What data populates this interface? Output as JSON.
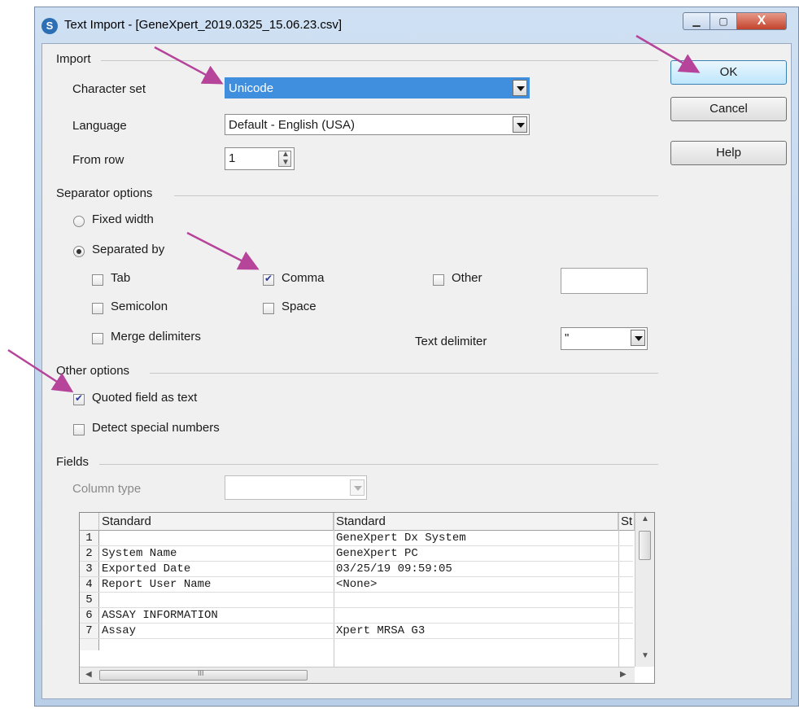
{
  "window": {
    "title": "Text Import - [GeneXpert_2019.0325_15.06.23.csv]",
    "app_icon": "S",
    "minimize_glyph": "▁",
    "maximize_glyph": "▢",
    "close_glyph": "X"
  },
  "buttons": {
    "ok": "OK",
    "cancel": "Cancel",
    "help": "Help"
  },
  "import": {
    "section": "Import",
    "charset_label": "Character set",
    "charset_value": "Unicode",
    "language_label": "Language",
    "language_value": "Default - English (USA)",
    "from_row_label": "From row",
    "from_row_value": "1"
  },
  "separator": {
    "section": "Separator options",
    "fixed_width": "Fixed width",
    "separated_by": "Separated by",
    "tab": "Tab",
    "comma": "Comma",
    "other": "Other",
    "semicolon": "Semicolon",
    "space": "Space",
    "merge": "Merge delimiters",
    "text_delimiter_label": "Text delimiter",
    "text_delimiter_value": "\""
  },
  "other": {
    "section": "Other options",
    "quoted": "Quoted field as text",
    "detect": "Detect special numbers"
  },
  "fields": {
    "section": "Fields",
    "column_type_label": "Column type",
    "headers": [
      "Standard",
      "Standard",
      "St"
    ],
    "rows": [
      [
        "1",
        "",
        "GeneXpert Dx System"
      ],
      [
        "2",
        "System Name",
        "GeneXpert PC"
      ],
      [
        "3",
        "Exported Date",
        "03/25/19 09:59:05"
      ],
      [
        "4",
        "Report User Name",
        "<None>"
      ],
      [
        "5",
        "",
        ""
      ],
      [
        "6",
        "ASSAY INFORMATION",
        ""
      ],
      [
        "7",
        "Assay",
        "Xpert MRSA G3"
      ]
    ],
    "scroll_glyph": "III"
  },
  "colors": {
    "arrow": "#b5449a",
    "highlight": "#3f8fde"
  }
}
